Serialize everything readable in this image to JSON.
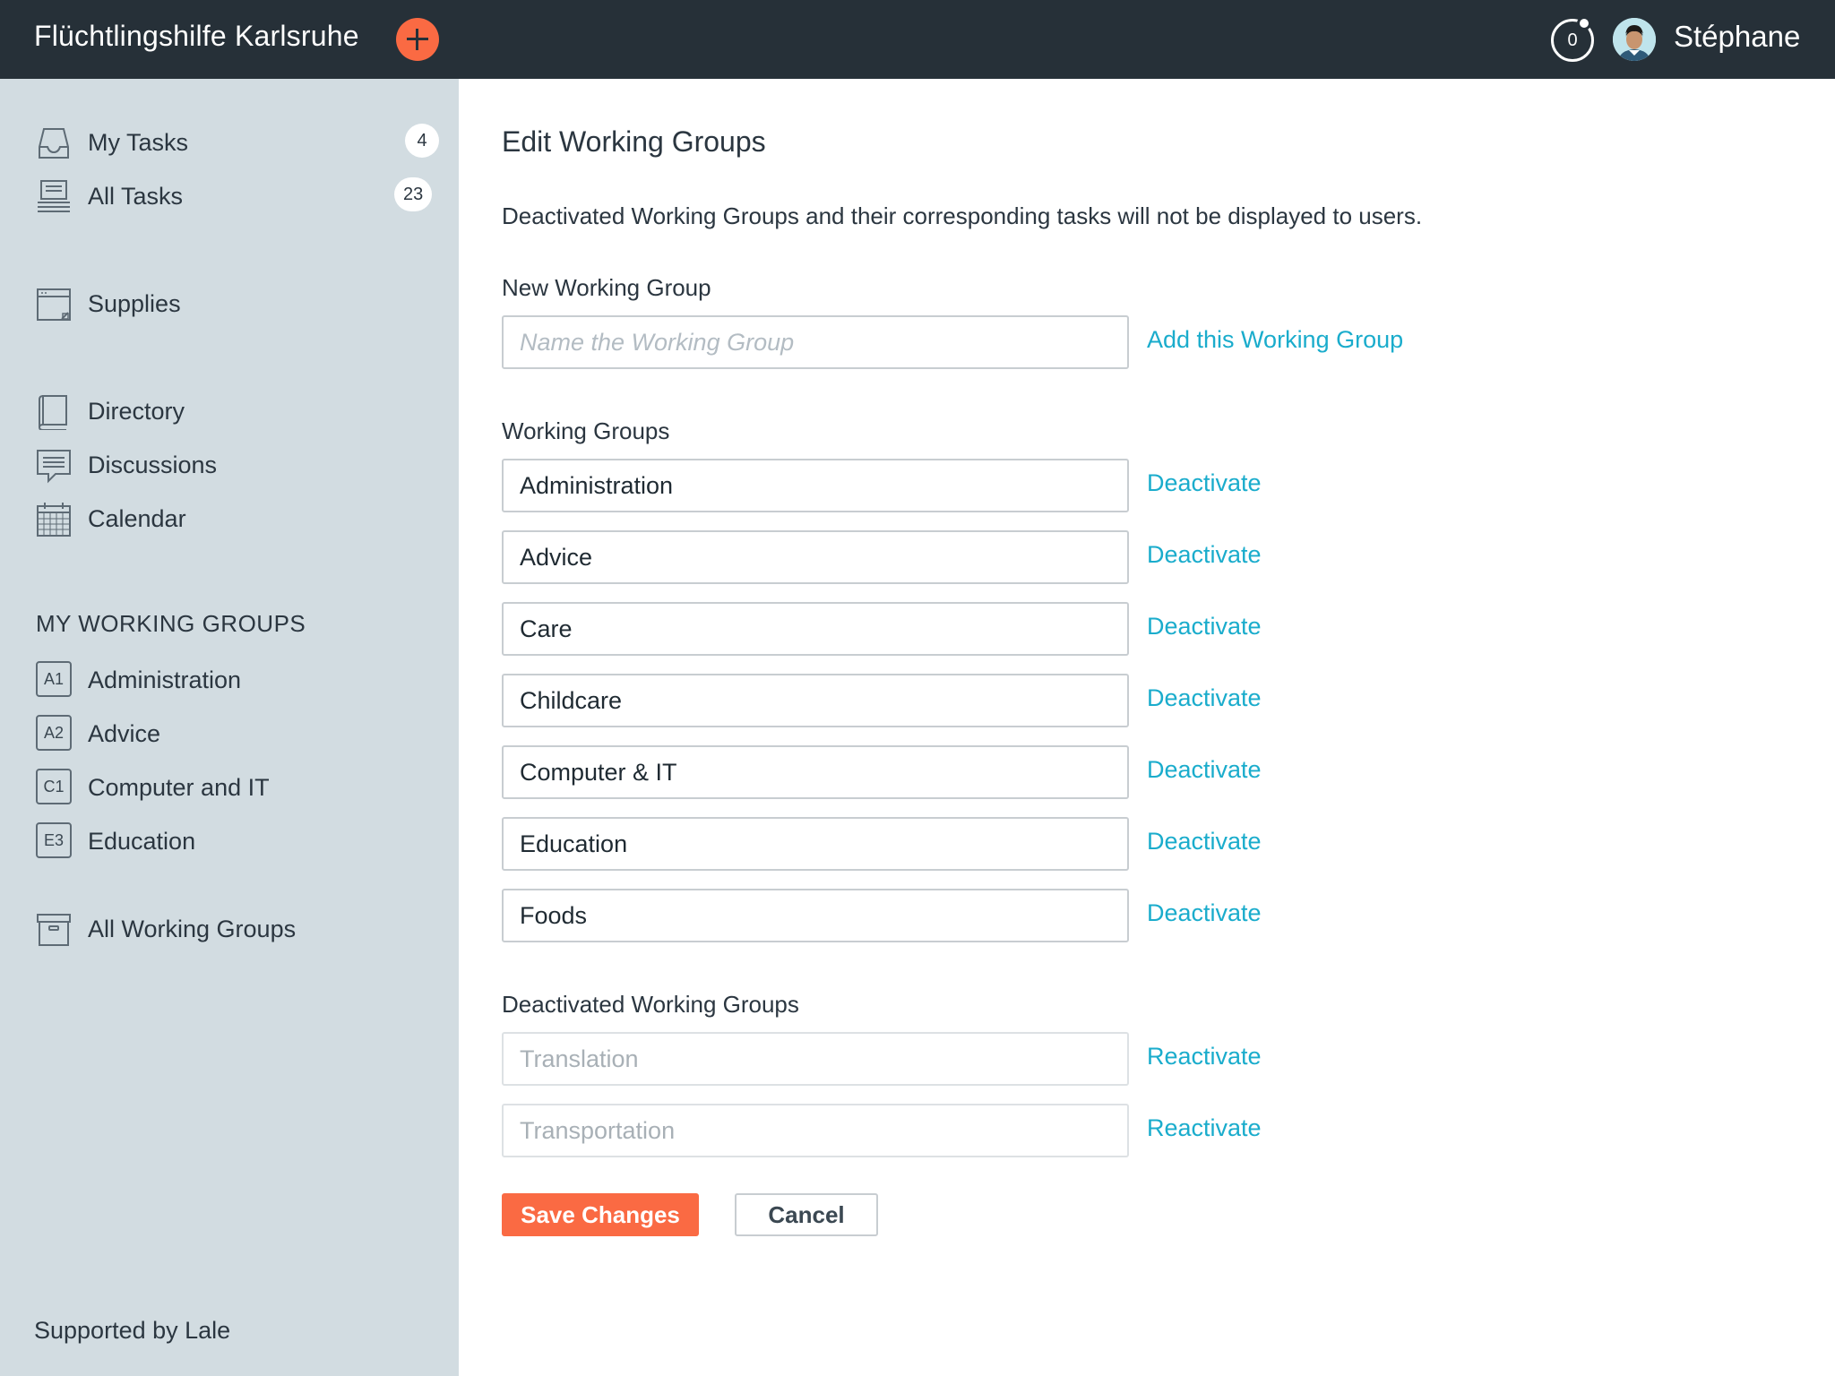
{
  "header": {
    "app_title": "Flüchtlingshilfe Karlsruhe",
    "add_icon": "plus-icon",
    "notification_count": "0",
    "user_name": "Stéphane",
    "colors": {
      "bar": "#263038",
      "accent": "#fa6a43"
    }
  },
  "sidebar": {
    "tasks": [
      {
        "label": "My Tasks",
        "count": "4",
        "icon": "inbox-icon"
      },
      {
        "label": "All Tasks",
        "count": "23",
        "icon": "stack-icon"
      }
    ],
    "supplies": {
      "label": "Supplies",
      "icon": "browser-window-icon"
    },
    "tools": [
      {
        "label": "Directory",
        "icon": "book-icon"
      },
      {
        "label": "Discussions",
        "icon": "chat-bubble-icon"
      },
      {
        "label": "Calendar",
        "icon": "calendar-icon"
      }
    ],
    "my_groups_title": "MY WORKING GROUPS",
    "my_groups": [
      {
        "badge": "A1",
        "label": "Administration"
      },
      {
        "badge": "A2",
        "label": "Advice"
      },
      {
        "badge": "C1",
        "label": "Computer and IT"
      },
      {
        "badge": "E3",
        "label": "Education"
      }
    ],
    "all_groups": {
      "label": "All Working Groups",
      "icon": "archive-box-icon"
    },
    "footer": "Supported by Lale"
  },
  "main": {
    "title": "Edit Working Groups",
    "description": "Deactivated Working Groups and their corresponding tasks will not be displayed to users.",
    "new_group": {
      "label": "New Working Group",
      "placeholder": "Name the Working Group",
      "add_link": "Add this Working Group"
    },
    "active": {
      "label": "Working Groups",
      "action": "Deactivate",
      "groups": [
        "Administration",
        "Advice",
        "Care",
        "Childcare",
        "Computer & IT",
        "Education",
        "Foods"
      ]
    },
    "deactivated": {
      "label": "Deactivated Working Groups",
      "action": "Reactivate",
      "groups": [
        "Translation",
        "Transportation"
      ]
    },
    "save_label": "Save Changes",
    "cancel_label": "Cancel",
    "link_color": "#1aaccc"
  }
}
